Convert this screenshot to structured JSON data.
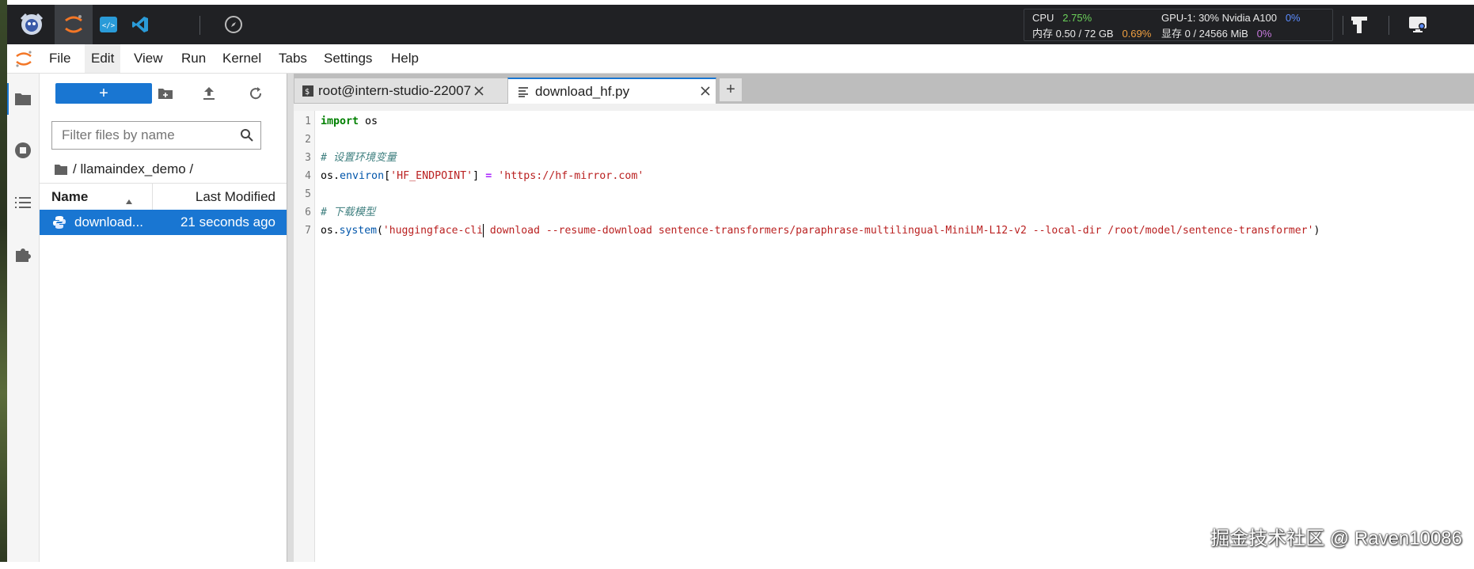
{
  "topbar": {
    "monitor": {
      "cpu_label": "CPU",
      "cpu_value": "2.75%",
      "mem_label": "内存 0.50 / 72 GB",
      "mem_value": "0.69%",
      "gpu_label": "GPU-1: 30% Nvidia A100",
      "gpu_value": "0%",
      "vram_label": "显存 0 / 24566 MiB",
      "vram_value": "0%"
    },
    "icons": [
      "intern-logo-icon",
      "jupyter-icon",
      "code-server-icon",
      "vscode-icon",
      "compass-icon",
      "model-icon",
      "remote-desktop-icon"
    ]
  },
  "menu": {
    "items": [
      "File",
      "Edit",
      "View",
      "Run",
      "Kernel",
      "Tabs",
      "Settings",
      "Help"
    ],
    "active": "Edit"
  },
  "filebrowser": {
    "new_label": "+",
    "filter_placeholder": "Filter files by name",
    "breadcrumb": "/ llamaindex_demo /",
    "columns": {
      "name": "Name",
      "modified": "Last Modified"
    },
    "files": [
      {
        "name": "download...",
        "modified": "21 seconds ago",
        "selected": true
      }
    ]
  },
  "tabs": [
    {
      "label": "root@intern-studio-22007",
      "type": "terminal",
      "active": false
    },
    {
      "label": "download_hf.py",
      "type": "file",
      "active": true
    }
  ],
  "tab_add": "+",
  "editor": {
    "line_numbers": [
      "1",
      "2",
      "3",
      "4",
      "5",
      "6",
      "7"
    ],
    "lines": [
      {
        "kw": "import",
        "rest": " os"
      },
      {},
      {
        "comment": "# 设置环境变量"
      },
      {
        "a": "os.",
        "fn": "environ",
        "b": "[",
        "str1": "'HF_ENDPOINT'",
        "c": "] ",
        "op": "=",
        "d": " ",
        "str2": "'https://hf-mirror.com'"
      },
      {},
      {
        "comment": "# 下载模型"
      },
      {
        "a": "os.",
        "fn": "system",
        "b": "(",
        "str_pre": "'huggingface-cli",
        "str_post": " download --resume-download sentence-transformers/paraphrase-multilingual-MiniLM-L12-v2 --local-dir /root/model/sentence-transformer'",
        "c": ")"
      }
    ]
  },
  "watermark": "掘金技术社区 @ Raven10086",
  "colors": {
    "accent": "#1976d2",
    "topbar": "#202124"
  }
}
